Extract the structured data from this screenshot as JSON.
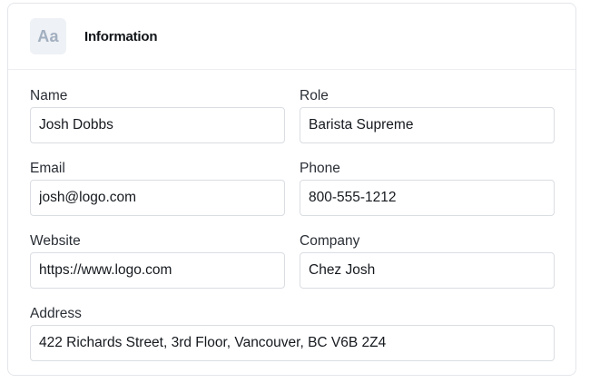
{
  "header": {
    "icon_text": "Aa",
    "icon_name": "font-type-icon",
    "title": "Information"
  },
  "form": {
    "name": {
      "label": "Name",
      "value": "Josh Dobbs"
    },
    "role": {
      "label": "Role",
      "value": "Barista Supreme"
    },
    "email": {
      "label": "Email",
      "value": "josh@logo.com"
    },
    "phone": {
      "label": "Phone",
      "value": "800-555-1212"
    },
    "website": {
      "label": "Website",
      "value": "https://www.logo.com"
    },
    "company": {
      "label": "Company",
      "value": "Chez Josh"
    },
    "address": {
      "label": "Address",
      "value": "422 Richards Street, 3rd Floor, Vancouver, BC V6B 2Z4"
    }
  },
  "colors": {
    "icon_background": "#eef1f5",
    "icon_text": "#a2afbf",
    "border": "#dadde2"
  }
}
